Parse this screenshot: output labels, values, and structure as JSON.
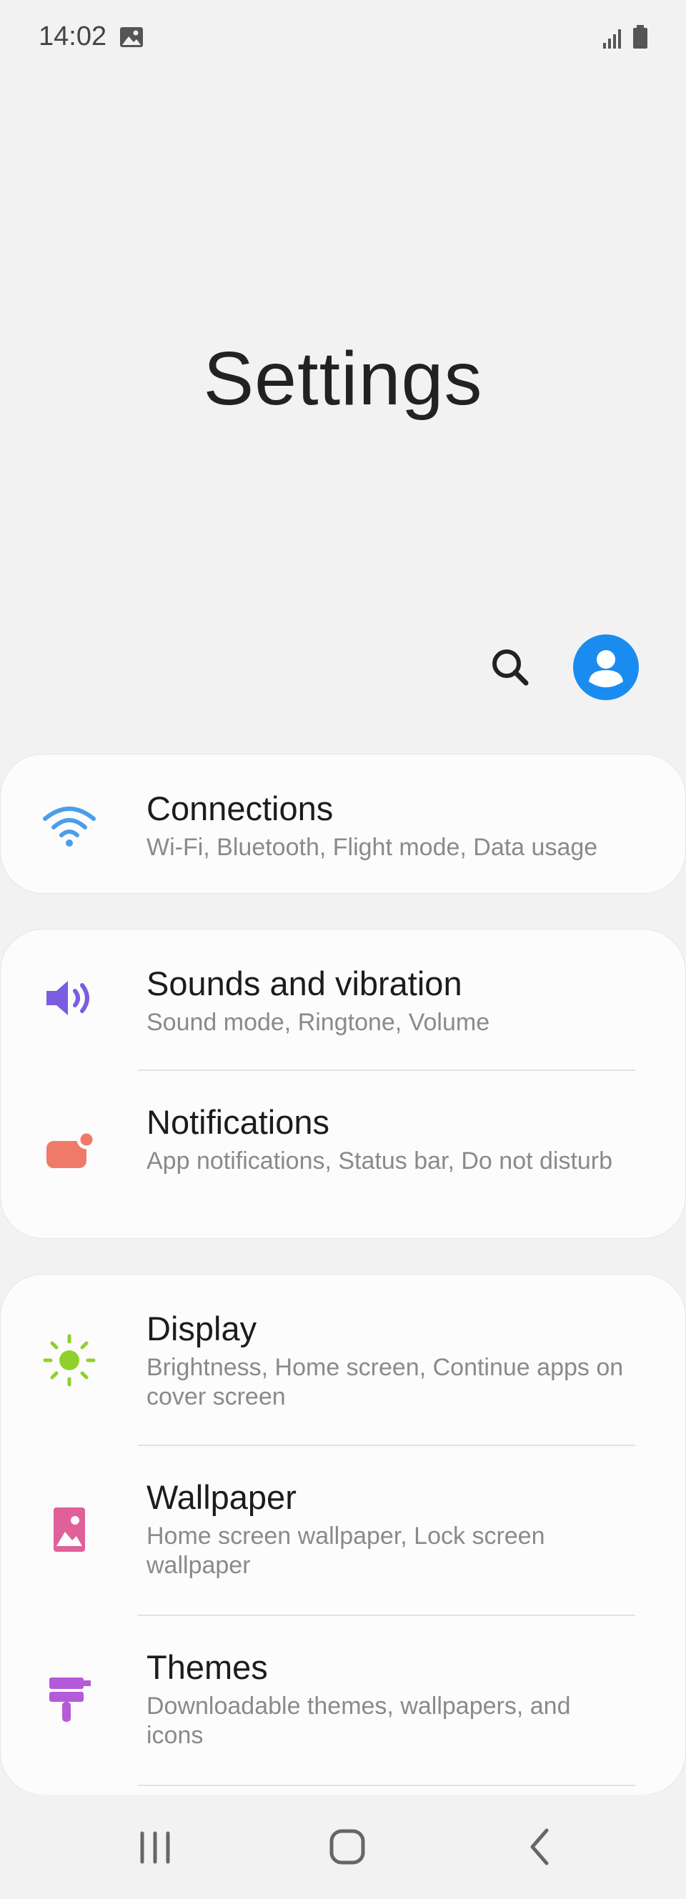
{
  "status_bar": {
    "time": "14:02"
  },
  "page": {
    "title": "Settings"
  },
  "colors": {
    "accent": "#1a8cf0",
    "wifi": "#4a9ee8",
    "sound": "#7a5de0",
    "notif": "#f07a6a",
    "display": "#8fd12a",
    "wallpaper": "#e0609a",
    "themes": "#b55ad8"
  },
  "cards": [
    {
      "items": [
        {
          "icon": "wifi-icon",
          "title": "Connections",
          "subtitle": "Wi-Fi, Bluetooth, Flight mode, Data usage"
        }
      ]
    },
    {
      "items": [
        {
          "icon": "speaker-icon",
          "title": "Sounds and vibration",
          "subtitle": "Sound mode, Ringtone, Volume"
        },
        {
          "icon": "notification-icon",
          "title": "Notifications",
          "subtitle": "App notifications, Status bar, Do not disturb"
        }
      ]
    },
    {
      "items": [
        {
          "icon": "sun-icon",
          "title": "Display",
          "subtitle": "Brightness, Home screen, Continue apps on cover screen"
        },
        {
          "icon": "wallpaper-icon",
          "title": "Wallpaper",
          "subtitle": "Home screen wallpaper, Lock screen wallpaper"
        },
        {
          "icon": "brush-icon",
          "title": "Themes",
          "subtitle": "Downloadable themes, wallpapers, and icons"
        }
      ]
    }
  ]
}
